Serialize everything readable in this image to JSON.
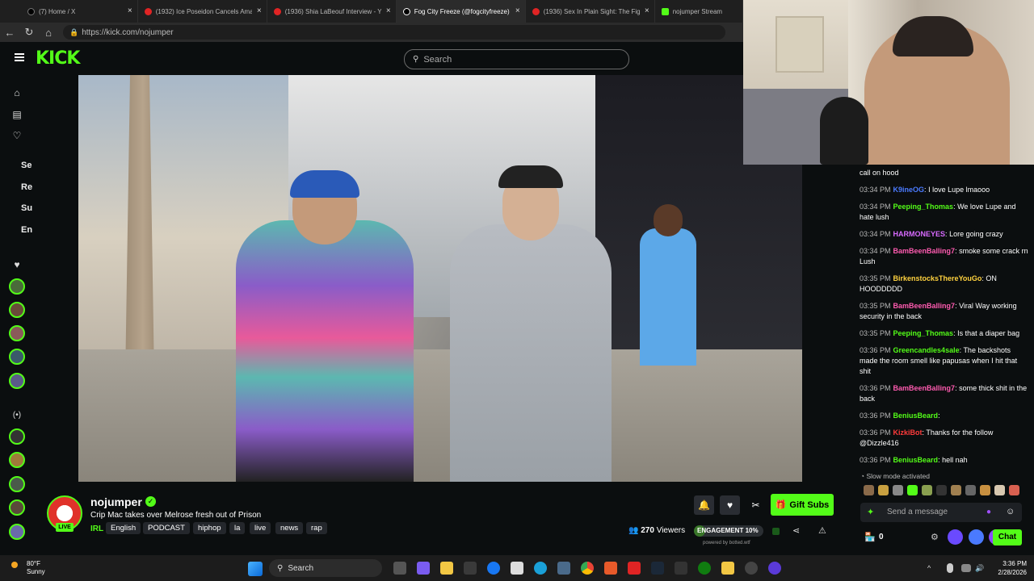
{
  "browser": {
    "tabs": [
      {
        "label": "(7) Home / X",
        "active": false
      },
      {
        "label": "(1932) Ice Poseidon Cancels Amaz",
        "active": false
      },
      {
        "label": "(1936) Shia LaBeouf Interview - Yo",
        "active": false
      },
      {
        "label": "Fog City Freeze (@fogcityfreeze) |",
        "active": true
      },
      {
        "label": "(1936) Sex In Plain Sight: The Figu",
        "active": false
      },
      {
        "label": "nojumper Stream",
        "active": false
      }
    ],
    "url": "https://kick.com/nojumper"
  },
  "header": {
    "logo": "KICK",
    "search_placeholder": "Search"
  },
  "sidebar": {
    "section_letters": [
      "Se",
      "Re",
      "Su",
      "En"
    ]
  },
  "stream": {
    "channel": "nojumper",
    "live_badge": "LIVE",
    "title": "Crip Mac takes over Melrose fresh out of Prison",
    "category": "IRL",
    "tags": [
      "English",
      "PODCAST",
      "hiphop",
      "la",
      "live",
      "news",
      "rap"
    ],
    "viewers_count": "270",
    "viewers_label": "Viewers",
    "engagement_label": "ENGAGEMENT",
    "engagement_value": "10%",
    "engagement_fraction": 0.1,
    "powered_by": "powered by botted.wtf",
    "gift_subs_label": "Gift Subs"
  },
  "chat": {
    "messages": [
      {
        "time": "",
        "user": "",
        "text": "call on hood",
        "color": "#ffffff"
      },
      {
        "time": "03:34 PM",
        "user": "K9ineOG",
        "text": "I love Lupe lmaooo",
        "color": "#4b7bff"
      },
      {
        "time": "03:34 PM",
        "user": "Peeping_Thomas",
        "text": "We love Lupe and hate lush",
        "color": "#53fc18"
      },
      {
        "time": "03:34 PM",
        "user": "HARMONEYES",
        "text": "Lore going crazy",
        "color": "#d86bff"
      },
      {
        "time": "03:34 PM",
        "user": "BamBeenBalling7",
        "text": "smoke some crack rn Lush",
        "color": "#ff5bb0"
      },
      {
        "time": "03:35 PM",
        "user": "BirkenstocksThereYouGo",
        "text": "ON HOODDDDD",
        "color": "#ffd23f"
      },
      {
        "time": "03:35 PM",
        "user": "BamBeenBalling7",
        "text": "Viral Way working security in the back",
        "color": "#ff5bb0"
      },
      {
        "time": "03:35 PM",
        "user": "Peeping_Thomas",
        "text": "Is that a diaper bag",
        "color": "#53fc18"
      },
      {
        "time": "03:36 PM",
        "user": "Greencandles4sale",
        "text": "The backshots made the room smell like papusas when I hit that shit",
        "color": "#53fc18"
      },
      {
        "time": "03:36 PM",
        "user": "BamBeenBalling7",
        "text": "some thick shit in the back",
        "color": "#ff5bb0"
      },
      {
        "time": "03:36 PM",
        "user": "BeniusBeard",
        "text": "",
        "color": "#53fc18"
      },
      {
        "time": "03:36 PM",
        "user": "KizkiBot",
        "text": "Thanks for the follow @Dizzle416",
        "color": "#ff3b3b"
      },
      {
        "time": "03:36 PM",
        "user": "BeniusBeard",
        "text": "hell nah",
        "color": "#53fc18"
      }
    ],
    "slow_mode": "Slow mode activated",
    "send_placeholder": "Send a message",
    "points": "0",
    "chat_button": "Chat"
  },
  "taskbar": {
    "weather_temp": "80°F",
    "weather_desc": "Sunny",
    "search_label": "Search",
    "time": "3:36 PM",
    "date": "2/28/2026"
  },
  "colors": {
    "kick_green": "#53fc18",
    "background": "#0b0e0f"
  }
}
